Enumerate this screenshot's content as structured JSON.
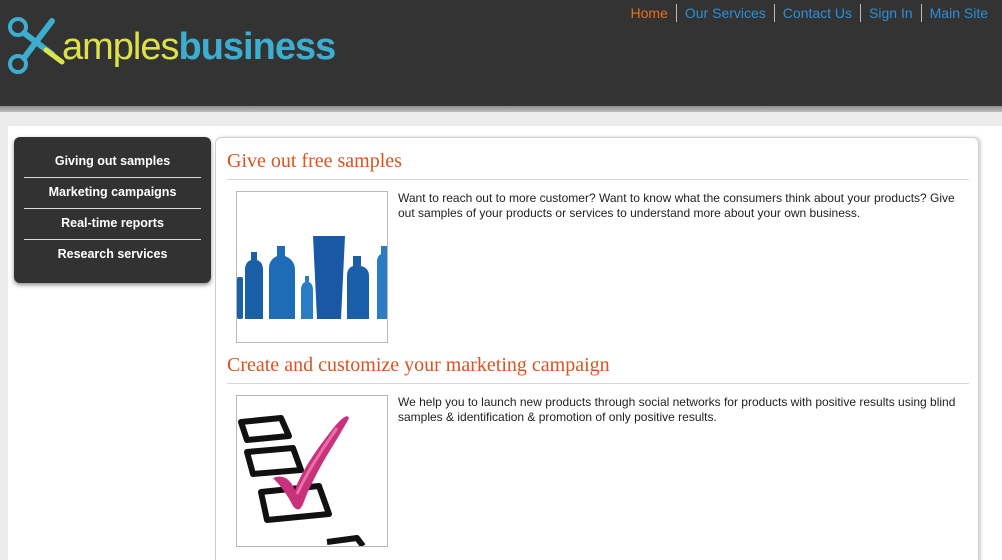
{
  "header": {
    "logo_prefix": "amples",
    "logo_suffix": "business",
    "logo_icon": "scissors-x-icon"
  },
  "topnav": {
    "items": [
      {
        "label": "Home",
        "active": true
      },
      {
        "label": "Our Services",
        "active": false
      },
      {
        "label": "Contact Us",
        "active": false
      },
      {
        "label": "Sign In",
        "active": false
      },
      {
        "label": "Main Site",
        "active": false
      }
    ]
  },
  "sidebar": {
    "items": [
      {
        "label": "Giving out samples"
      },
      {
        "label": "Marketing campaigns"
      },
      {
        "label": "Real-time reports"
      },
      {
        "label": "Research services"
      }
    ]
  },
  "sections": [
    {
      "title": "Give out free samples",
      "text": "Want to reach out to more customer? Want to know what the consumers think about your products? Give out samples of your products or services to understand more about your own business.",
      "image": "blue-bottles-image"
    },
    {
      "title": "Create and customize your marketing campaign",
      "text": "We help you to launch new products through social networks for products with positive results using blind samples & identification & promotion of only positive results.",
      "image": "checklist-checkmark-image"
    }
  ],
  "colors": {
    "header_bg": "#333333",
    "nav_link": "#2e8fd8",
    "nav_active": "#e8701c",
    "section_title": "#d9541e",
    "logo_yellow": "#dce24a",
    "logo_blue": "#3eaed0",
    "sidebar_bg": "#323232"
  }
}
